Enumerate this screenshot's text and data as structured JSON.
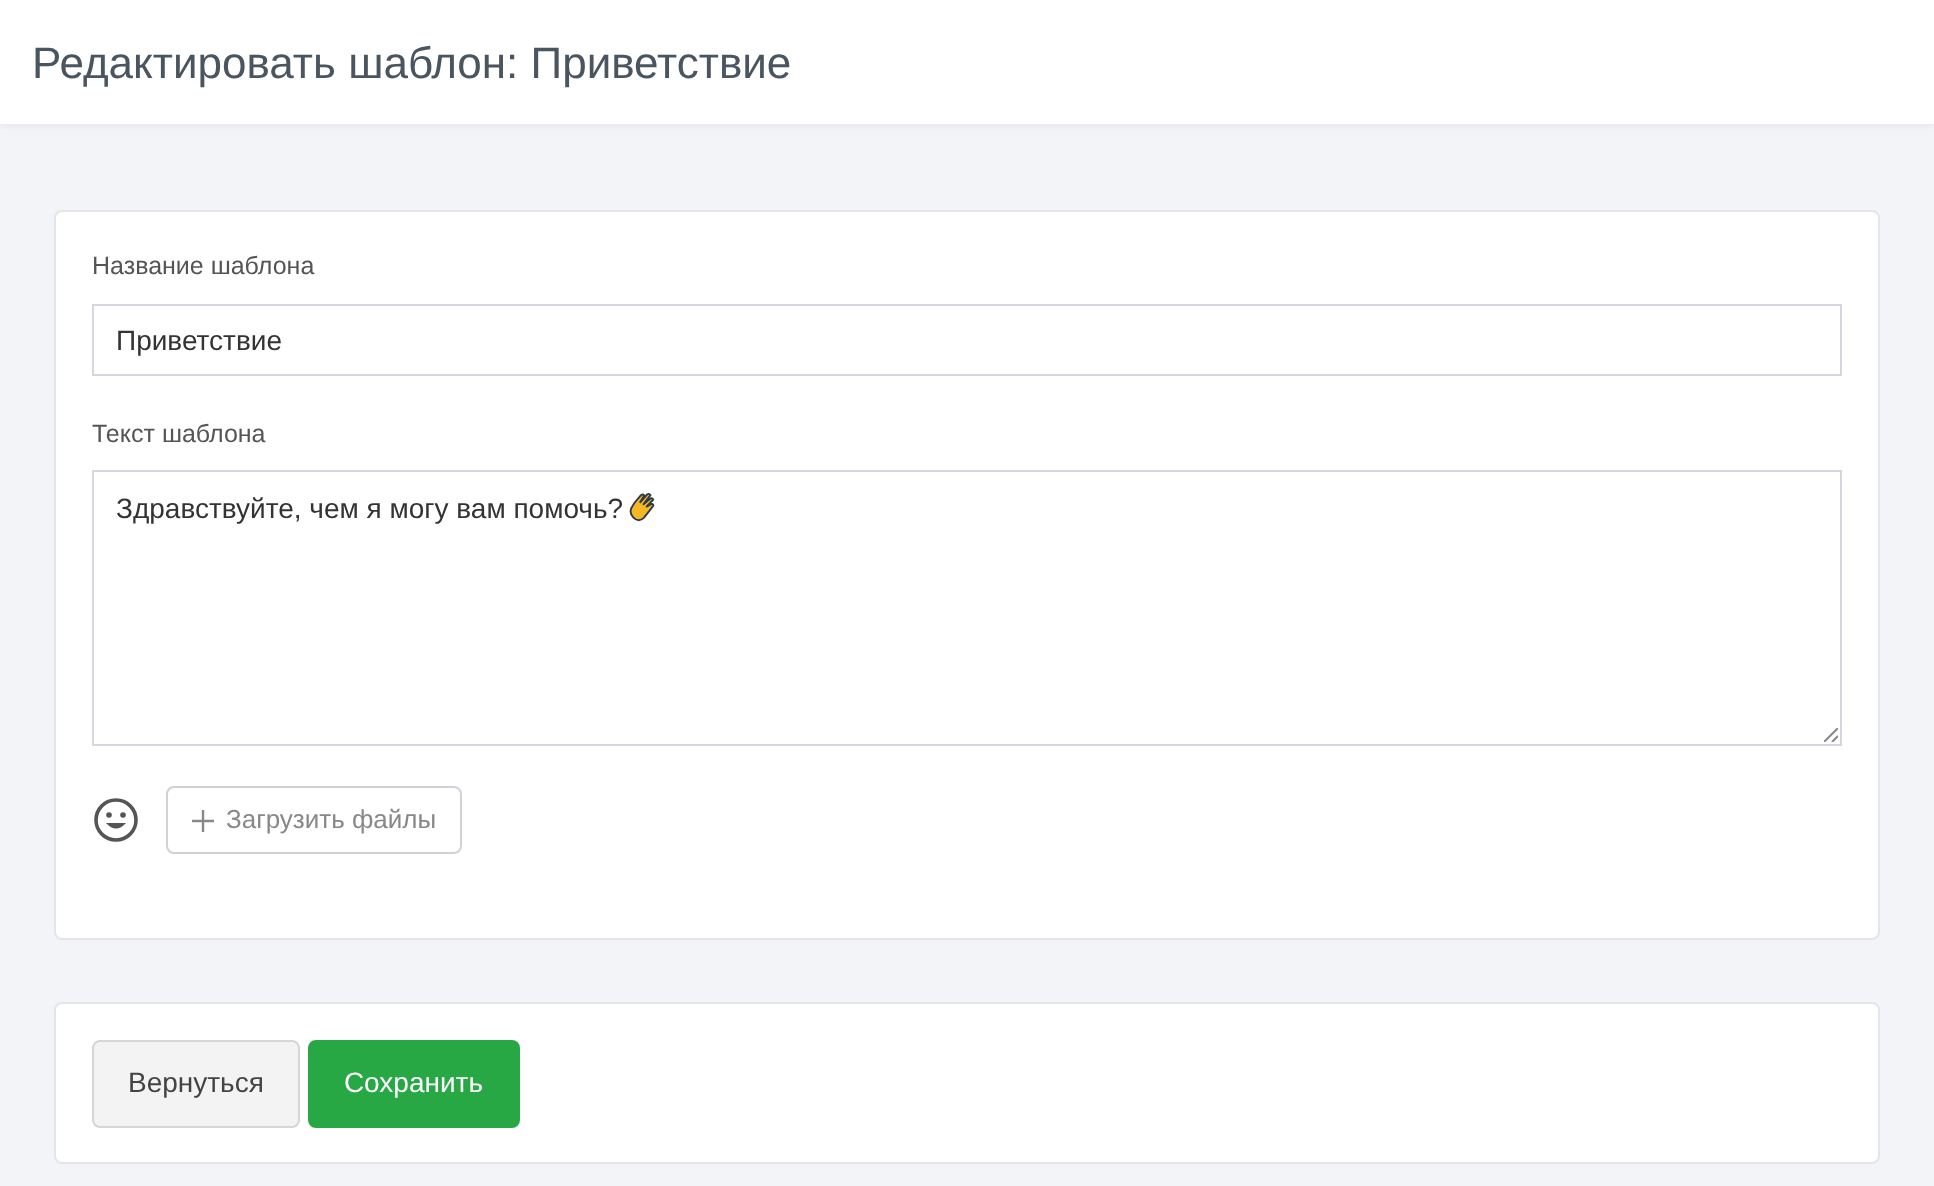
{
  "header": {
    "title": "Редактировать шаблон: Приветствие"
  },
  "form": {
    "name_label": "Название шаблона",
    "name_value": "Приветствие",
    "text_label": "Текст шаблона",
    "text_value": "Здравствуйте, чем я могу вам помочь?",
    "upload_button": "Загрузить файлы"
  },
  "actions": [
    {
      "label": "Вернуться",
      "kind": "secondary"
    },
    {
      "label": "Сохранить",
      "kind": "primary"
    }
  ]
}
